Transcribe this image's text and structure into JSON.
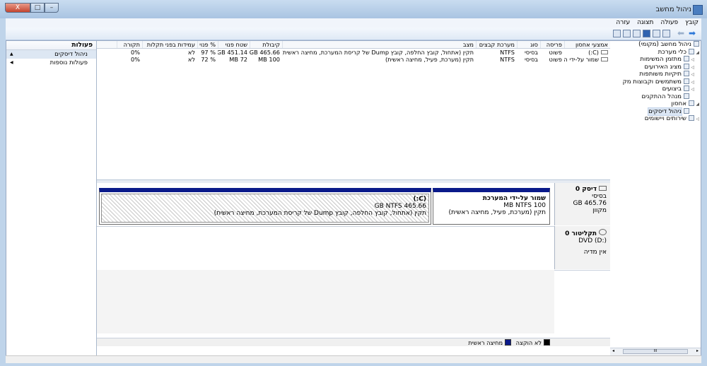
{
  "window": {
    "title": "ניהול מחשב",
    "close_glyph": "X"
  },
  "menu": [
    "קובץ",
    "פעולה",
    "תצוגה",
    "עזרה"
  ],
  "tree": [
    {
      "label": "ניהול מחשב (מקומי)",
      "level": 0,
      "expanded": true
    },
    {
      "label": "כלי מערכת",
      "level": 1,
      "expanded": true
    },
    {
      "label": "מתזמן המשימות",
      "level": 2
    },
    {
      "label": "מציג האירועים",
      "level": 2
    },
    {
      "label": "תיקיות משותפות",
      "level": 2
    },
    {
      "label": "משתמשים וקבוצות מק",
      "level": 2
    },
    {
      "label": "ביצועים",
      "level": 2
    },
    {
      "label": "מנהל ההתקנים",
      "level": 2
    },
    {
      "label": "אחסון",
      "level": 1,
      "expanded": true
    },
    {
      "label": "ניהול דיסקים",
      "level": 2,
      "selected": true
    },
    {
      "label": "שירותים ויישומים",
      "level": 1
    }
  ],
  "tree_scroll": {
    "thumb_glyph": "III"
  },
  "volumes": {
    "columns": [
      "אמצעי אחסון",
      "פריסה",
      "סוג",
      "מערכת קבצים",
      "מצב",
      "קיבולת",
      "שטח פנוי",
      "% פנוי",
      "עמידות בפני תקלות",
      "תקורה"
    ],
    "rows": [
      [
        "(C:)",
        "פשוט",
        "בסיסי",
        "NTFS",
        "תקין (אתחול, קובץ החלפה, קובץ Dump של קריסת המערכת, מחיצה ראשית)",
        "GB 465.66",
        "GB 451.14",
        "% 97",
        "לא",
        "0%"
      ],
      [
        "שמור על-ידי המערכת",
        "פשוט",
        "בסיסי",
        "NTFS",
        "תקין (מערכת, פעיל, מחיצה ראשית)",
        "MB 100",
        "MB 72",
        "% 72",
        "לא",
        "0%"
      ]
    ]
  },
  "disk0": {
    "name": "דיסק 0",
    "type": "בסיסי",
    "size": "GB 465.76",
    "status": "מקוון",
    "partitions": [
      {
        "title": "שמור על-ידי המערכת",
        "size": "MB NTFS 100",
        "status": "תקין (מערכת, פעיל, מחיצה ראשית)"
      },
      {
        "title": "(C:)",
        "size": "GB NTFS 465.66",
        "status": "תקין (אתחול, קובץ החלפה, קובץ Dump של קריסת המערכת, מחיצה ראשית)"
      }
    ]
  },
  "cdrom0": {
    "name": "תקליטור 0",
    "drive": "DVD (D:)",
    "media": "אין מדיה"
  },
  "legend": [
    {
      "label": "לא הוקצה",
      "color": "#000000"
    },
    {
      "label": "מחיצה ראשית",
      "color": "#0a1a8a"
    }
  ],
  "actions": {
    "header": "פעולות",
    "section": "ניהול דיסקים",
    "more": "פעולות נוספות"
  }
}
